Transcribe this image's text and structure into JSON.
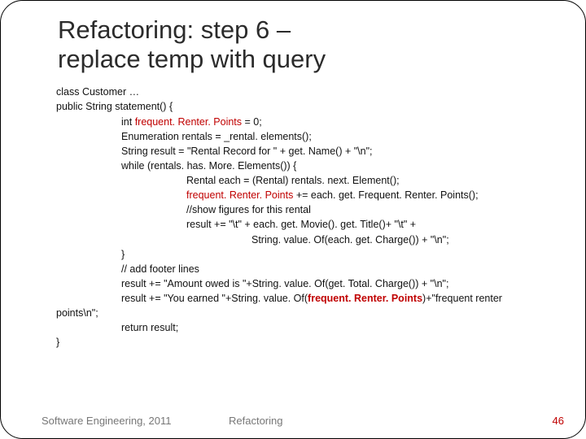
{
  "title_line1": "Refactoring: step 6 –",
  "title_line2": "replace temp with query",
  "code": {
    "l1": "class Customer …",
    "l2": "public String statement() {",
    "l3a": "int ",
    "l3b": "frequent. Renter. Points",
    "l3c": " = 0;",
    "l4": "Enumeration rentals = _rental. elements();",
    "l5": "String result = \"Rental Record for \" + get. Name() + \"\\n\";",
    "l6": "while (rentals. has. More. Elements()) {",
    "l7": "Rental each = (Rental) rentals. next. Element();",
    "l8a": "frequent. Renter. Points",
    "l8b": " += each. get. Frequent. Renter. Points();",
    "l9": "//show figures for this rental",
    "l10": "result += \"\\t\" + each. get. Movie(). get. Title()+ \"\\t\" +",
    "l11": "String. value. Of(each. get. Charge()) + \"\\n\";",
    "l12": "}",
    "l13": "// add footer lines",
    "l14": "result += \"Amount owed is \"+String. value. Of(get. Total. Charge()) + \"\\n\";",
    "l15a": "result += \"You earned \"+String. value. Of(",
    "l15b": "frequent. Renter. Points",
    "l15c": ")+\"frequent renter",
    "l16": "points\\n\";",
    "l17": "return result;",
    "l18": "}"
  },
  "footer": {
    "left": "Software Engineering, 2011",
    "center": "Refactoring",
    "page": "46"
  }
}
